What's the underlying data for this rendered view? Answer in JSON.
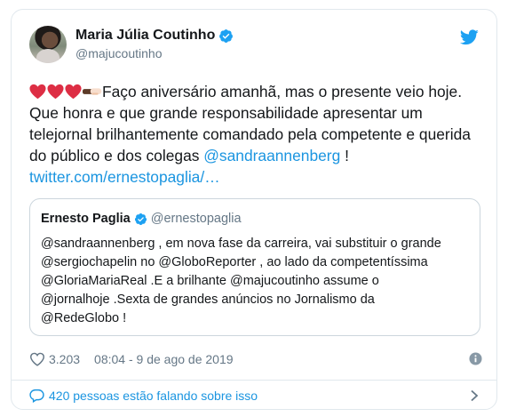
{
  "author": {
    "display_name": "Maria Júlia Coutinho",
    "handle": "@majucoutinho"
  },
  "tweet": {
    "text_main": "Faço aniversário amanhã, mas o presente veio hoje. Que honra e que grande responsabilidade apresentar um telejornal brilhantemente comandado pela competente e querida do público e dos colegas ",
    "mention": "@sandraannenberg",
    "text_end": " !",
    "link": "twitter.com/ernestopaglia/…",
    "emojis": [
      "red-heart",
      "red-heart",
      "red-heart",
      "handshake-dark-light"
    ]
  },
  "quote": {
    "display_name": "Ernesto Paglia",
    "handle": "@ernestopaglia",
    "lines": [
      "@sandraannenberg , em nova fase da carreira, vai substituir o grande",
      "@sergiochapelin no @GloboReporter , ao lado da competentíssima",
      "@GloriaMariaReal .E a brilhante @majucoutinho assume o",
      "@jornalhoje .Sexta de grandes anúncios no Jornalismo da",
      "@RedeGlobo !"
    ]
  },
  "meta": {
    "likes": "3.203",
    "timestamp": "08:04 - 9 de ago de 2019"
  },
  "footer": {
    "conversation": "420 pessoas estão falando sobre isso"
  },
  "colors": {
    "accent": "#1b95e0",
    "text": "#14171a",
    "muted": "#657786",
    "border": "#e1e8ed",
    "heart": "#e0245e"
  },
  "icons": [
    "verified-badge-icon",
    "twitter-bird-icon",
    "heart-outline-icon",
    "info-icon",
    "reply-bubble-icon",
    "chevron-right-icon"
  ]
}
